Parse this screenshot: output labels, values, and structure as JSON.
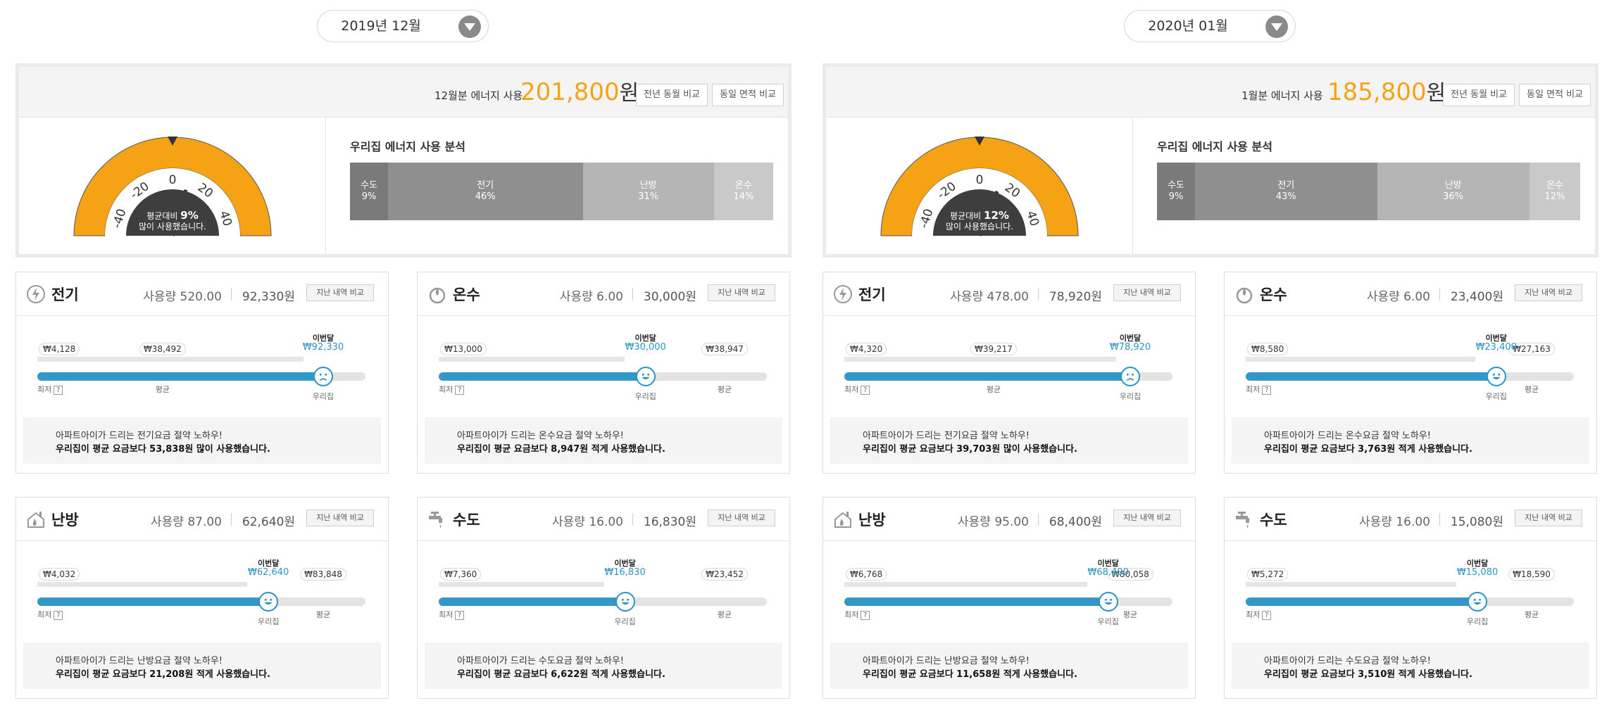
{
  "colors": {
    "accent": "#f5a314",
    "bar_fill": "#3397c7",
    "face": "#2c94c4",
    "gauge": "#f5a314",
    "gauge_center": "#3e3e3e"
  },
  "panels": [
    {
      "month": "2019년 12월",
      "summary": {
        "label": "12월분 에너지 사용",
        "amount": "201,800",
        "unit": "원",
        "btn_yoy": "전년 동월 비교",
        "btn_area": "동일 면적 비교"
      },
      "gauge": {
        "ticks": [
          "-40",
          "-20",
          "0",
          "20",
          "40"
        ],
        "line1": "평균대비",
        "pct": "9%",
        "line2": "많이 사용했습니다.",
        "value": 9
      },
      "analysis": {
        "title": "우리집 에너지 사용 분석",
        "segments": [
          {
            "name": "수도",
            "pct": "9%",
            "value": 9,
            "color": "#7a7a7a"
          },
          {
            "name": "전기",
            "pct": "46%",
            "value": 46,
            "color": "#8f8f8f"
          },
          {
            "name": "난방",
            "pct": "31%",
            "value": 31,
            "color": "#b5b5b5"
          },
          {
            "name": "온수",
            "pct": "14%",
            "value": 14,
            "color": "#c9c9c9"
          }
        ]
      },
      "cards": [
        {
          "icon": "electricity-icon",
          "name": "전기",
          "usage": "사용량 520.00",
          "cost": "92,330원",
          "btn": "지난 내역 비교",
          "face": "sad",
          "min_label": "₩4,128",
          "mid_label": "₩38,492",
          "cur_title": "이번달",
          "cur_label": "₩92,330",
          "end_label": "",
          "bottom_min": "최저",
          "bottom_mid": "평균",
          "bottom_cur": "우리집",
          "bottom_end": "",
          "min": 4128,
          "avg": 38492,
          "cur": 92330,
          "max": 92330,
          "tip1": "아파트아이가 드리는 전기요금 절약 노하우!",
          "tip2": "우리집이 평균 요금보다 53,838원 많이 사용했습니다."
        },
        {
          "icon": "hot-water-icon",
          "name": "온수",
          "usage": "사용량 6.00",
          "cost": "30,000원",
          "btn": "지난 내역 비교",
          "face": "happy",
          "min_label": "₩13,000",
          "mid_label": "",
          "cur_title": "이번달",
          "cur_label": "₩30,000",
          "end_label": "₩38,947",
          "bottom_min": "최저",
          "bottom_mid": "",
          "bottom_cur": "우리집",
          "bottom_end": "평균",
          "min": 13000,
          "avg": 38947,
          "cur": 30000,
          "max": 38947,
          "tip1": "아파트아이가 드리는 온수요금 절약 노하우!",
          "tip2": "우리집이 평균 요금보다 8,947원 적게 사용했습니다."
        },
        {
          "icon": "heating-icon",
          "name": "난방",
          "usage": "사용량 87.00",
          "cost": "62,640원",
          "btn": "지난 내역 비교",
          "face": "happy",
          "min_label": "₩4,032",
          "mid_label": "",
          "cur_title": "이번달",
          "cur_label": "₩62,640",
          "end_label": "₩83,848",
          "bottom_min": "최저",
          "bottom_mid": "",
          "bottom_cur": "우리집",
          "bottom_end": "평균",
          "min": 4032,
          "avg": 83848,
          "cur": 62640,
          "max": 83848,
          "tip1": "아파트아이가 드리는 난방요금 절약 노하우!",
          "tip2": "우리집이 평균 요금보다 21,208원 적게 사용했습니다."
        },
        {
          "icon": "water-tap-icon",
          "name": "수도",
          "usage": "사용량 16.00",
          "cost": "16,830원",
          "btn": "지난 내역 비교",
          "face": "happy",
          "min_label": "₩7,360",
          "mid_label": "",
          "cur_title": "이번달",
          "cur_label": "₩16,830",
          "end_label": "₩23,452",
          "bottom_min": "최저",
          "bottom_mid": "",
          "bottom_cur": "우리집",
          "bottom_end": "평균",
          "min": 7360,
          "avg": 23452,
          "cur": 16830,
          "max": 23452,
          "tip1": "아파트아이가 드리는 수도요금 절약 노하우!",
          "tip2": "우리집이 평균 요금보다 6,622원 적게 사용했습니다."
        }
      ]
    },
    {
      "month": "2020년 01월",
      "summary": {
        "label": "1월분 에너지 사용",
        "amount": "185,800",
        "unit": "원",
        "btn_yoy": "전년 동월 비교",
        "btn_area": "동일 면적 비교"
      },
      "gauge": {
        "ticks": [
          "-40",
          "-20",
          "0",
          "20",
          "40"
        ],
        "line1": "평균대비",
        "pct": "12%",
        "line2": "많이 사용했습니다.",
        "value": 12
      },
      "analysis": {
        "title": "우리집 에너지 사용 분석",
        "segments": [
          {
            "name": "수도",
            "pct": "9%",
            "value": 9,
            "color": "#7a7a7a"
          },
          {
            "name": "전기",
            "pct": "43%",
            "value": 43,
            "color": "#8f8f8f"
          },
          {
            "name": "난방",
            "pct": "36%",
            "value": 36,
            "color": "#b5b5b5"
          },
          {
            "name": "온수",
            "pct": "12%",
            "value": 12,
            "color": "#c9c9c9"
          }
        ]
      },
      "cards": [
        {
          "icon": "electricity-icon",
          "name": "전기",
          "usage": "사용량 478.00",
          "cost": "78,920원",
          "btn": "지난 내역 비교",
          "face": "sad",
          "min_label": "₩4,320",
          "mid_label": "₩39,217",
          "cur_title": "이번달",
          "cur_label": "₩78,920",
          "end_label": "",
          "bottom_min": "최저",
          "bottom_mid": "평균",
          "bottom_cur": "우리집",
          "bottom_end": "",
          "min": 4320,
          "avg": 39217,
          "cur": 78920,
          "max": 78920,
          "tip1": "아파트아이가 드리는 전기요금 절약 노하우!",
          "tip2": "우리집이 평균 요금보다 39,703원 많이 사용했습니다."
        },
        {
          "icon": "hot-water-icon",
          "name": "온수",
          "usage": "사용량 6.00",
          "cost": "23,400원",
          "btn": "지난 내역 비교",
          "face": "happy",
          "min_label": "₩8,580",
          "mid_label": "",
          "cur_title": "이번달",
          "cur_label": "₩23,400",
          "end_label": "₩27,163",
          "bottom_min": "최저",
          "bottom_mid": "",
          "bottom_cur": "우리집",
          "bottom_end": "평균",
          "min": 8580,
          "avg": 27163,
          "cur": 23400,
          "max": 27163,
          "tip1": "아파트아이가 드리는 온수요금 절약 노하우!",
          "tip2": "우리집이 평균 요금보다 3,763원 적게 사용했습니다."
        },
        {
          "icon": "heating-icon",
          "name": "난방",
          "usage": "사용량 95.00",
          "cost": "68,400원",
          "btn": "지난 내역 비교",
          "face": "happy",
          "min_label": "₩6,768",
          "mid_label": "",
          "cur_title": "이번달",
          "cur_label": "₩68,400",
          "end_label": "₩80,058",
          "bottom_min": "최저",
          "bottom_mid": "",
          "bottom_cur": "우리집",
          "bottom_end": "평균",
          "min": 6768,
          "avg": 80058,
          "cur": 68400,
          "max": 80058,
          "tip1": "아파트아이가 드리는 난방요금 절약 노하우!",
          "tip2": "우리집이 평균 요금보다 11,658원 적게 사용했습니다."
        },
        {
          "icon": "water-tap-icon",
          "name": "수도",
          "usage": "사용량 16.00",
          "cost": "15,080원",
          "btn": "지난 내역 비교",
          "face": "happy",
          "min_label": "₩5,272",
          "mid_label": "",
          "cur_title": "이번달",
          "cur_label": "₩15,080",
          "end_label": "₩18,590",
          "bottom_min": "최저",
          "bottom_mid": "",
          "bottom_cur": "우리집",
          "bottom_end": "평균",
          "min": 5272,
          "avg": 18590,
          "cur": 15080,
          "max": 18590,
          "tip1": "아파트아이가 드리는 수도요금 절약 노하우!",
          "tip2": "우리집이 평균 요금보다 3,510원 적게 사용했습니다."
        }
      ]
    }
  ]
}
